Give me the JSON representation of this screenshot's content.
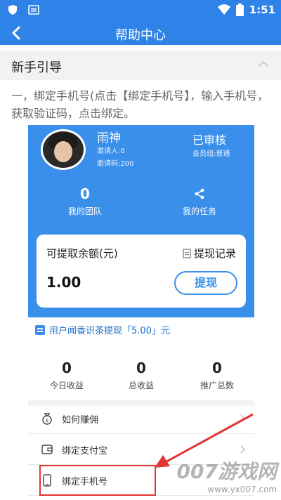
{
  "status_bar": {
    "time": "1:51"
  },
  "app_bar": {
    "title": "帮助中心"
  },
  "section": {
    "title": "新手引导"
  },
  "intro": {
    "text": "一，绑定手机号(点击【绑定手机号】，输入手机号，获取验证码，点击绑定。"
  },
  "profile": {
    "name": "雨神",
    "inviter": "邀请人:0",
    "invite_code": "邀请码:200",
    "verify_status": "已审核",
    "member_group": "会员组:普通",
    "team_count": "0",
    "team_label": "我的团队",
    "task_label": "我的任务"
  },
  "wallet": {
    "title": "可提取余额(元)",
    "record_label": "提现记录",
    "amount": "1.00",
    "withdraw_label": "提现"
  },
  "notice": {
    "text": "用户闻香识茶提现「5.00」元"
  },
  "earnings": [
    {
      "value": "0",
      "label": "今日收益"
    },
    {
      "value": "0",
      "label": "总收益"
    },
    {
      "value": "0",
      "label": "推广总数"
    }
  ],
  "menu": [
    {
      "label": "如何赚佣",
      "icon": "money-bag-icon"
    },
    {
      "label": "绑定支付宝",
      "icon": "wallet-icon"
    },
    {
      "label": "绑定手机号",
      "icon": "phone-icon"
    }
  ],
  "watermark": {
    "brand": "007游戏网",
    "url": "www.yx007.com"
  },
  "colors": {
    "primary": "#2f83e8",
    "highlight": "#e33333"
  }
}
